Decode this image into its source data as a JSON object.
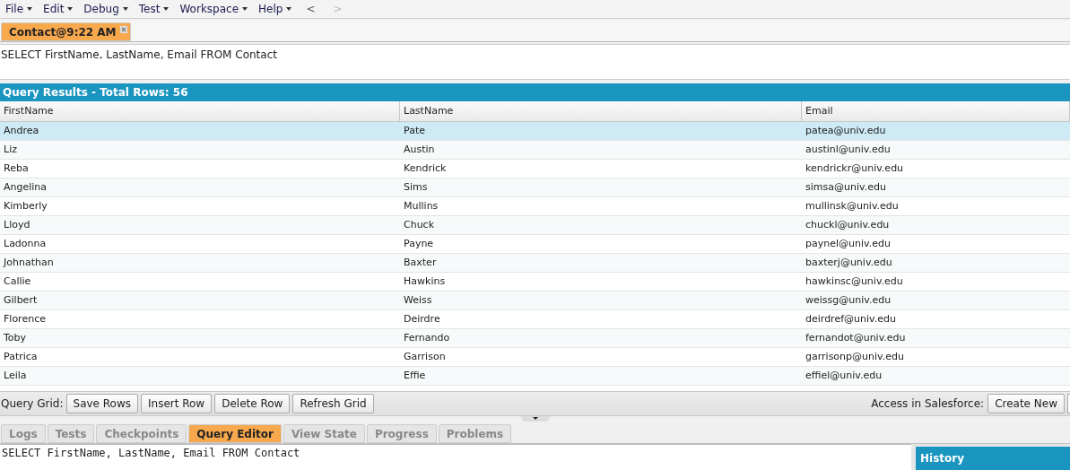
{
  "menu": [
    "File",
    "Edit",
    "Debug",
    "Test",
    "Workspace",
    "Help"
  ],
  "nav": {
    "back": "<",
    "forward": ">"
  },
  "editor_tabs": [
    {
      "label": "Contact@9:22 AM",
      "selected": true
    }
  ],
  "query": "SELECT FirstName, LastName, Email FROM Contact",
  "results": {
    "title": "Query Results - Total Rows: 56",
    "columns": [
      "FirstName",
      "LastName",
      "Email"
    ],
    "rows": [
      {
        "cells": [
          "Andrea",
          "Pate",
          "patea@univ.edu"
        ],
        "selected": true
      },
      {
        "cells": [
          "Liz",
          "Austin",
          "austinl@univ.edu"
        ],
        "selected": false
      },
      {
        "cells": [
          "Reba",
          "Kendrick",
          "kendrickr@univ.edu"
        ],
        "selected": false
      },
      {
        "cells": [
          "Angelina",
          "Sims",
          "simsa@univ.edu"
        ],
        "selected": false
      },
      {
        "cells": [
          "Kimberly",
          "Mullins",
          "mullinsk@univ.edu"
        ],
        "selected": false
      },
      {
        "cells": [
          "Lloyd",
          "Chuck",
          "chuckl@univ.edu"
        ],
        "selected": false
      },
      {
        "cells": [
          "Ladonna",
          "Payne",
          "paynel@univ.edu"
        ],
        "selected": false
      },
      {
        "cells": [
          "Johnathan",
          "Baxter",
          "baxterj@univ.edu"
        ],
        "selected": false
      },
      {
        "cells": [
          "Callie",
          "Hawkins",
          "hawkinsc@univ.edu"
        ],
        "selected": false
      },
      {
        "cells": [
          "Gilbert",
          "Weiss",
          "weissg@univ.edu"
        ],
        "selected": false
      },
      {
        "cells": [
          "Florence",
          "Deirdre",
          "deirdref@univ.edu"
        ],
        "selected": false
      },
      {
        "cells": [
          "Toby",
          "Fernando",
          "fernandot@univ.edu"
        ],
        "selected": false
      },
      {
        "cells": [
          "Patrica",
          "Garrison",
          "garrisonp@univ.edu"
        ],
        "selected": false
      },
      {
        "cells": [
          "Leila",
          "Effie",
          "effiel@univ.edu"
        ],
        "selected": false
      }
    ]
  },
  "grid_toolbar": {
    "label": "Query Grid:",
    "buttons": [
      "Save Rows",
      "Insert Row",
      "Delete Row",
      "Refresh Grid"
    ],
    "access_label": "Access in Salesforce:",
    "access_buttons": [
      "Create New"
    ]
  },
  "panel_tabs": [
    {
      "label": "Logs",
      "selected": false
    },
    {
      "label": "Tests",
      "selected": false
    },
    {
      "label": "Checkpoints",
      "selected": false
    },
    {
      "label": "Query Editor",
      "selected": true
    },
    {
      "label": "View State",
      "selected": false
    },
    {
      "label": "Progress",
      "selected": false
    },
    {
      "label": "Problems",
      "selected": false
    }
  ],
  "bottom_query": "SELECT FirstName, LastName, Email FROM Contact",
  "history": {
    "title": "History"
  }
}
